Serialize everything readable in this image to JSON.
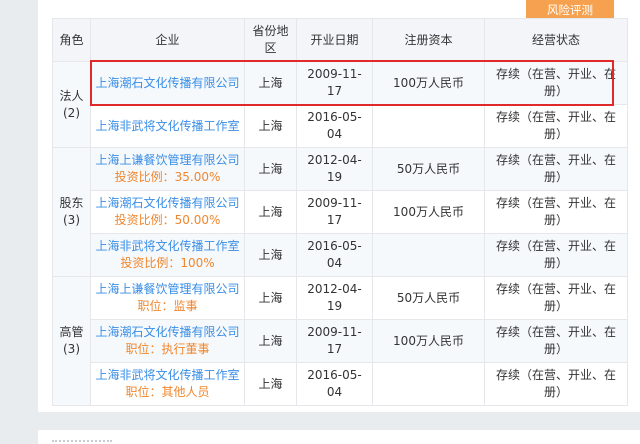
{
  "toolbar": {
    "risk_button": "风险评测"
  },
  "table": {
    "headers": {
      "role": "角色",
      "company": "企业",
      "province": "省份地区",
      "date": "开业日期",
      "capital": "注册资本",
      "status": "经营状态"
    },
    "groups": [
      {
        "role": "法人",
        "count": "(2)",
        "rows": [
          {
            "company": "上海潮石文化传播有限公司",
            "sub": "",
            "province": "上海",
            "date": "2009-11-17",
            "capital": "100万人民币",
            "status": "存续（在营、开业、在册）"
          },
          {
            "company": "上海非武将文化传播工作室",
            "sub": "",
            "province": "上海",
            "date": "2016-05-04",
            "capital": "",
            "status": "存续（在营、开业、在册）"
          }
        ]
      },
      {
        "role": "股东",
        "count": "(3)",
        "rows": [
          {
            "company": "上海上谦餐饮管理有限公司",
            "sub": "投资比例：35.00%",
            "province": "上海",
            "date": "2012-04-19",
            "capital": "50万人民币",
            "status": "存续（在营、开业、在册）"
          },
          {
            "company": "上海潮石文化传播有限公司",
            "sub": "投资比例：50.00%",
            "province": "上海",
            "date": "2009-11-17",
            "capital": "100万人民币",
            "status": "存续（在营、开业、在册）"
          },
          {
            "company": "上海非武将文化传播工作室",
            "sub": "投资比例：100%",
            "province": "上海",
            "date": "2016-05-04",
            "capital": "",
            "status": "存续（在营、开业、在册）"
          }
        ]
      },
      {
        "role": "高管",
        "count": "(3)",
        "rows": [
          {
            "company": "上海上谦餐饮管理有限公司",
            "sub": "职位：监事",
            "province": "上海",
            "date": "2012-04-19",
            "capital": "50万人民币",
            "status": "存续（在营、开业、在册）"
          },
          {
            "company": "上海潮石文化传播有限公司",
            "sub": "职位：执行董事",
            "province": "上海",
            "date": "2009-11-17",
            "capital": "100万人民币",
            "status": "存续（在营、开业、在册）"
          },
          {
            "company": "上海非武将文化传播工作室",
            "sub": "职位：其他人员",
            "province": "上海",
            "date": "2016-05-04",
            "capital": "",
            "status": "存续（在营、开业、在册）"
          }
        ]
      }
    ]
  }
}
